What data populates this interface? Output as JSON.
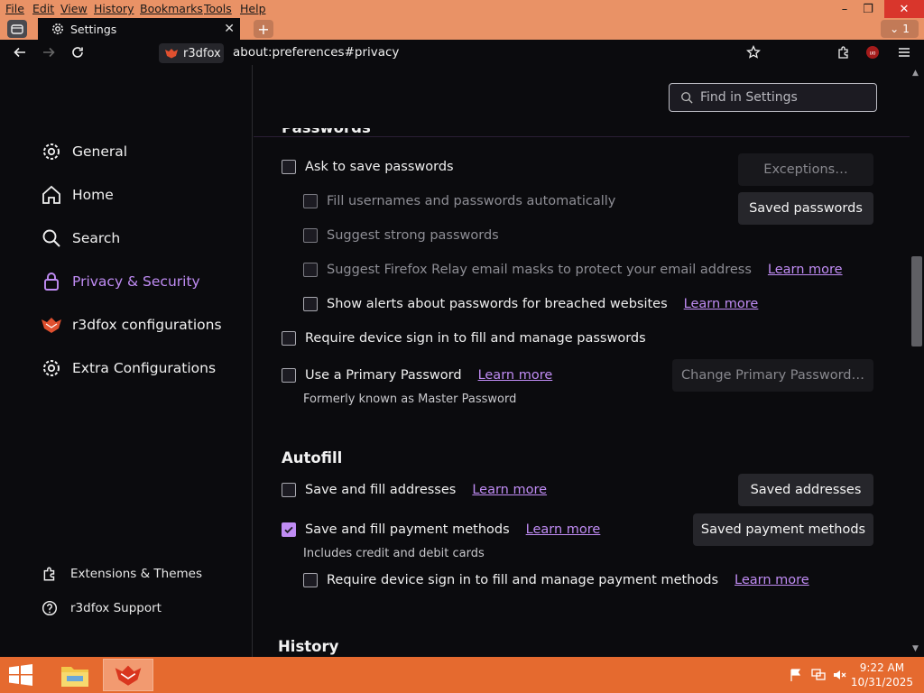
{
  "menubar": {
    "items": [
      "File",
      "Edit",
      "View",
      "History",
      "Bookmarks",
      "Tools",
      "Help"
    ],
    "window_controls": {
      "minimize": "–",
      "restore": "❐",
      "close": "✕"
    }
  },
  "tabs": {
    "active_title": "Settings",
    "close_glyph": "✕",
    "new_tab_glyph": "+",
    "tab_count": "1",
    "list_glyph": "⌄"
  },
  "navbar": {
    "identity_label": "r3dfox",
    "url": "about:preferences#privacy"
  },
  "sidebar": {
    "categories": [
      {
        "label": "General",
        "icon": "gear-icon"
      },
      {
        "label": "Home",
        "icon": "home-icon"
      },
      {
        "label": "Search",
        "icon": "search-icon"
      },
      {
        "label": "Privacy & Security",
        "icon": "lock-icon",
        "selected": true
      },
      {
        "label": "r3dfox configurations",
        "icon": "r3dfox-icon"
      },
      {
        "label": "Extra Configurations",
        "icon": "gear-icon"
      }
    ],
    "footer": [
      {
        "label": "Extensions & Themes",
        "icon": "puzzle-icon"
      },
      {
        "label": "r3dfox Support",
        "icon": "help-icon"
      }
    ]
  },
  "search": {
    "placeholder": "Find in Settings"
  },
  "passwords": {
    "heading": "Passwords",
    "ask_to_save": "Ask to save passwords",
    "exceptions_button": "Exceptions…",
    "fill_auto": "Fill usernames and passwords automatically",
    "saved_passwords_button": "Saved passwords",
    "suggest_strong": "Suggest strong passwords",
    "relay": "Suggest Firefox Relay email masks to protect your email address",
    "relay_learn_more": "Learn more",
    "breach_alerts": "Show alerts about passwords for breached websites",
    "breach_learn_more": "Learn more",
    "device_signin": "Require device sign in to fill and manage passwords",
    "primary_password": "Use a Primary Password",
    "primary_learn_more": "Learn more",
    "change_primary_button": "Change Primary Password…",
    "formerly": "Formerly known as Master Password"
  },
  "autofill": {
    "heading": "Autofill",
    "addresses": "Save and fill addresses",
    "addresses_learn_more": "Learn more",
    "saved_addresses_button": "Saved addresses",
    "payment": "Save and fill payment methods",
    "payment_learn_more": "Learn more",
    "saved_payment_button": "Saved payment methods",
    "payment_note": "Includes credit and debit cards",
    "payment_device_signin": "Require device sign in to fill and manage payment methods",
    "payment_device_learn_more": "Learn more"
  },
  "history": {
    "heading": "History"
  },
  "taskbar": {
    "time": "9:22 AM",
    "date": "10/31/2025"
  },
  "colors": {
    "accent": "#c08cf4",
    "chrome": "#e99266",
    "taskbar": "#e56a2f"
  }
}
